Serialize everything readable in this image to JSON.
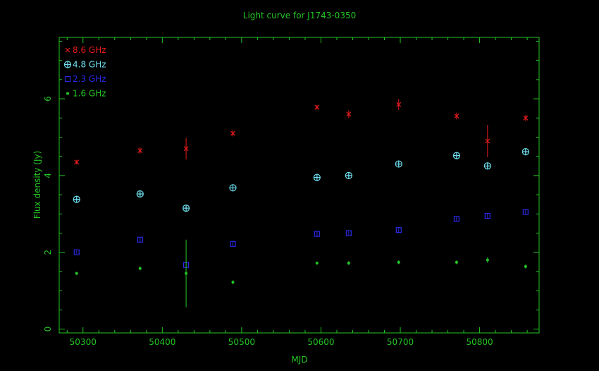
{
  "chart_data": {
    "type": "scatter",
    "title": "Light curve for J1743-0350",
    "xlabel": "MJD",
    "ylabel": "Flux density (Jy)",
    "xlim": [
      50270,
      50875
    ],
    "ylim": [
      -0.1,
      7.6
    ],
    "x_ticks": [
      50300,
      50400,
      50500,
      50600,
      50700,
      50800
    ],
    "y_ticks": [
      0,
      2,
      4,
      6
    ],
    "axis_color": "#23c623",
    "legend_position": "top-left",
    "series": [
      {
        "name": "8.6 GHz",
        "color": "#e81c1c",
        "marker": "cross",
        "points": [
          {
            "x": 50292,
            "y": 4.35,
            "err": 0.06
          },
          {
            "x": 50372,
            "y": 4.65,
            "err": 0.08
          },
          {
            "x": 50430,
            "y": 4.7,
            "err": 0.28
          },
          {
            "x": 50489,
            "y": 5.1,
            "err": 0.08
          },
          {
            "x": 50595,
            "y": 5.78,
            "err": 0.06
          },
          {
            "x": 50635,
            "y": 5.6,
            "err": 0.1
          },
          {
            "x": 50698,
            "y": 5.85,
            "err": 0.14
          },
          {
            "x": 50771,
            "y": 5.55,
            "err": 0.09
          },
          {
            "x": 50810,
            "y": 4.9,
            "err": 0.42
          },
          {
            "x": 50858,
            "y": 5.5,
            "err": 0.08
          }
        ]
      },
      {
        "name": "4.8 GHz",
        "color": "#6ee0f0",
        "marker": "circle-plus",
        "points": [
          {
            "x": 50292,
            "y": 3.38,
            "err": 0.04
          },
          {
            "x": 50372,
            "y": 3.52,
            "err": 0.05
          },
          {
            "x": 50430,
            "y": 3.15,
            "err": 0.05
          },
          {
            "x": 50489,
            "y": 3.68,
            "err": 0.05
          },
          {
            "x": 50595,
            "y": 3.95,
            "err": 0.04
          },
          {
            "x": 50635,
            "y": 4.0,
            "err": 0.04
          },
          {
            "x": 50698,
            "y": 4.3,
            "err": 0.05
          },
          {
            "x": 50771,
            "y": 4.52,
            "err": 0.05
          },
          {
            "x": 50810,
            "y": 4.25,
            "err": 0.08
          },
          {
            "x": 50858,
            "y": 4.62,
            "err": 0.05
          }
        ]
      },
      {
        "name": "2.3 GHz",
        "color": "#2a2ae6",
        "marker": "square",
        "points": [
          {
            "x": 50292,
            "y": 2.0,
            "err": 0.04
          },
          {
            "x": 50372,
            "y": 2.33,
            "err": 0.05
          },
          {
            "x": 50430,
            "y": 1.67,
            "err": 0.06
          },
          {
            "x": 50489,
            "y": 2.22,
            "err": 0.05
          },
          {
            "x": 50595,
            "y": 2.48,
            "err": 0.05
          },
          {
            "x": 50635,
            "y": 2.5,
            "err": 0.05
          },
          {
            "x": 50698,
            "y": 2.58,
            "err": 0.05
          },
          {
            "x": 50771,
            "y": 2.87,
            "err": 0.06
          },
          {
            "x": 50810,
            "y": 2.95,
            "err": 0.06
          },
          {
            "x": 50858,
            "y": 3.05,
            "err": 0.05
          }
        ]
      },
      {
        "name": "1.6 GHz",
        "color": "#23c623",
        "marker": "dot",
        "points": [
          {
            "x": 50292,
            "y": 1.45,
            "err": 0.04
          },
          {
            "x": 50372,
            "y": 1.58,
            "err": 0.05
          },
          {
            "x": 50430,
            "y": 1.45,
            "err": 0.88
          },
          {
            "x": 50489,
            "y": 1.22,
            "err": 0.05
          },
          {
            "x": 50595,
            "y": 1.72,
            "err": 0.04
          },
          {
            "x": 50635,
            "y": 1.72,
            "err": 0.05
          },
          {
            "x": 50698,
            "y": 1.74,
            "err": 0.05
          },
          {
            "x": 50771,
            "y": 1.74,
            "err": 0.05
          },
          {
            "x": 50810,
            "y": 1.8,
            "err": 0.07
          },
          {
            "x": 50858,
            "y": 1.63,
            "err": 0.05
          }
        ]
      }
    ]
  }
}
